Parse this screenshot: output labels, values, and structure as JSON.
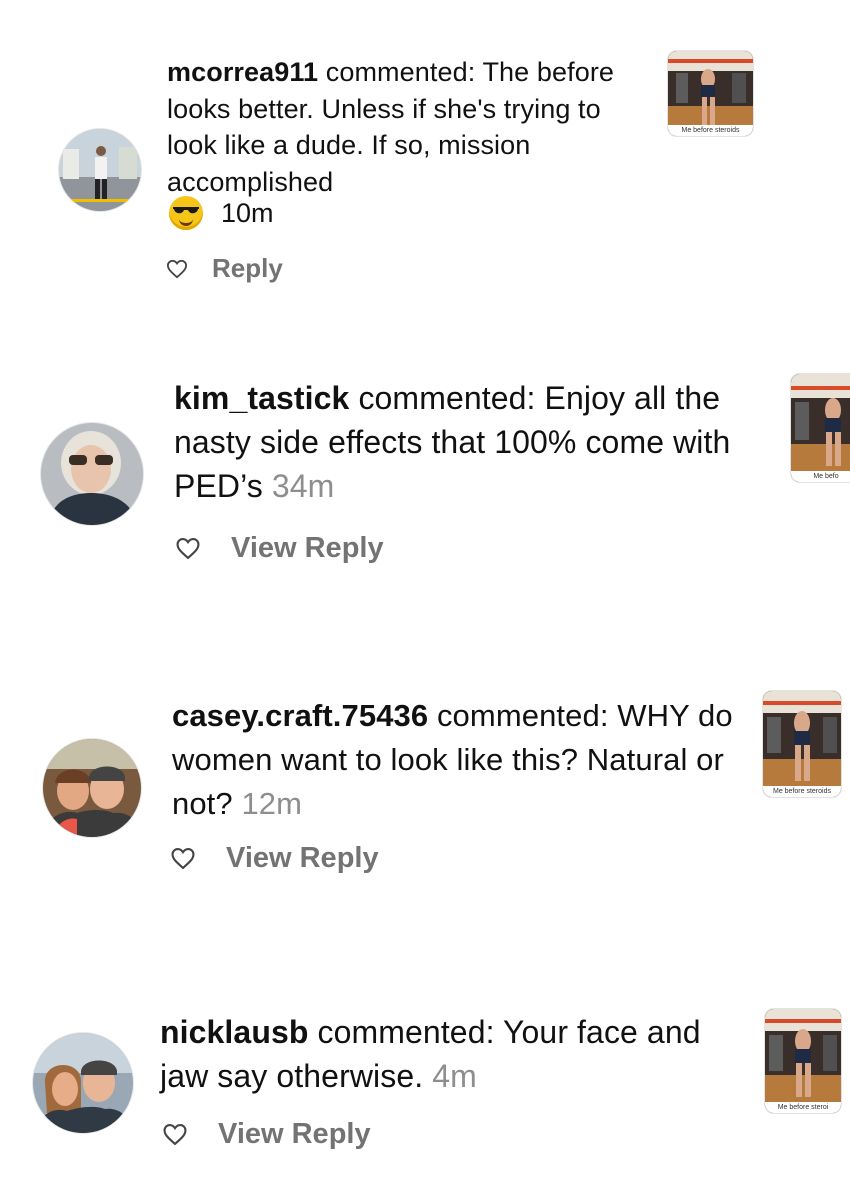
{
  "comments": [
    {
      "username": "mcorrea911",
      "verb": "commented:",
      "text": "The before looks better. Unless if she's trying to look like a dude. If so, mission accomplished",
      "time": "10m",
      "emoji": "smiling-face-with-sunglasses",
      "reply_label": "Reply",
      "thumb_caption": "Me before steroids"
    },
    {
      "username": "kim_tastick",
      "verb": "commented:",
      "text": "Enjoy all the nasty side effects that 100% come with PED’s",
      "time": "34m",
      "reply_label": "View Reply",
      "thumb_caption": "Me befo"
    },
    {
      "username": "casey.craft.75436",
      "verb": "commented:",
      "text": "WHY do women want to look like this? Natural or not?",
      "time": "12m",
      "reply_label": "View Reply",
      "thumb_caption": "Me before steroids"
    },
    {
      "username": "nicklausb",
      "verb": "commented:",
      "text": "Your face and jaw say otherwise.",
      "time": "4m",
      "reply_label": "View Reply",
      "thumb_caption": "Me before steroi"
    }
  ],
  "colors": {
    "text": "#111111",
    "muted": "#8e8e8e",
    "reply": "#737373",
    "background": "#ffffff"
  },
  "icons": {
    "like": "heart-outline-icon"
  }
}
